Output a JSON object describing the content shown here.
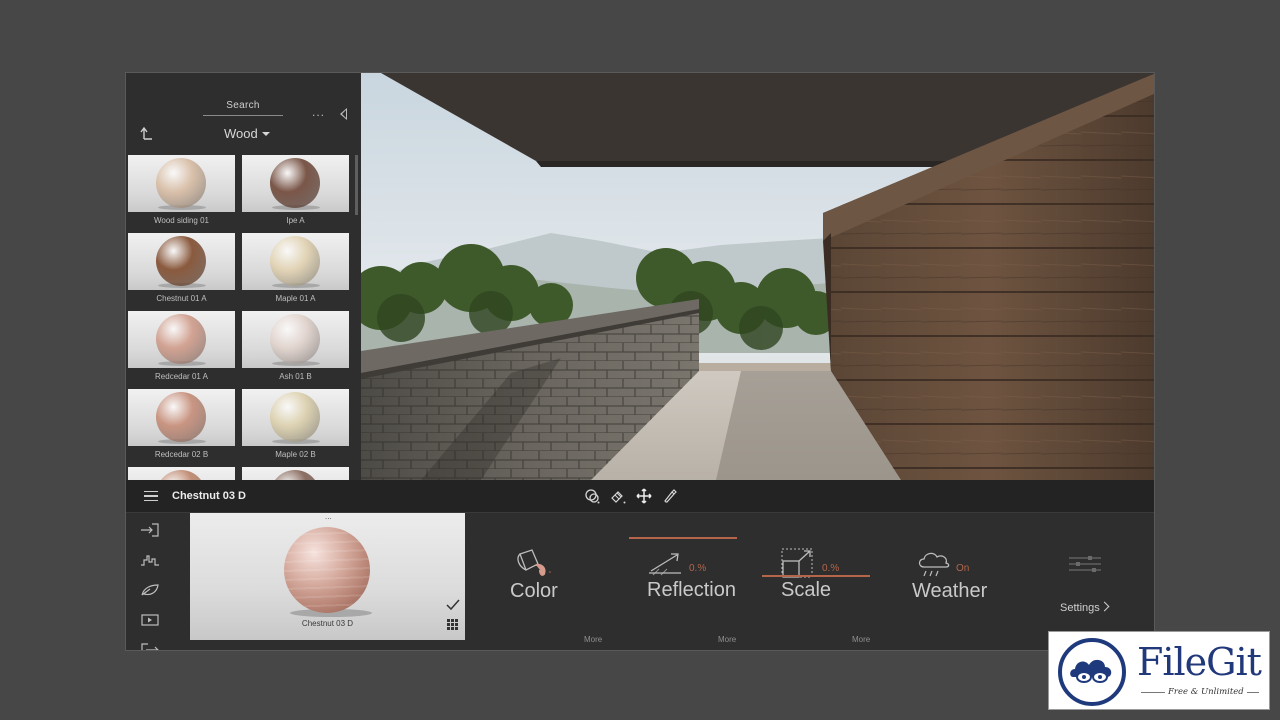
{
  "library": {
    "search_label": "Search",
    "more_label": "...",
    "category": "Wood",
    "materials": [
      {
        "name": "Wood siding 01",
        "tone": "#d9c0aa"
      },
      {
        "name": "Ipe A",
        "tone": "#7a5648"
      },
      {
        "name": "Chestnut 01 A",
        "tone": "#8a5a3e"
      },
      {
        "name": "Maple 01 A",
        "tone": "#e2d4b6"
      },
      {
        "name": "Redcedar 01 A",
        "tone": "#d2a393"
      },
      {
        "name": "Ash 01 B",
        "tone": "#e2d5cf"
      },
      {
        "name": "Redcedar 02 B",
        "tone": "#c99582"
      },
      {
        "name": "Maple 02 B",
        "tone": "#ddd2b2"
      },
      {
        "name": "",
        "tone": "#c28f77"
      },
      {
        "name": "",
        "tone": "#8b6e63"
      }
    ]
  },
  "toolbar": {
    "current_material": "Chestnut 03 D",
    "tools": [
      "material-picker-icon",
      "paint-icon",
      "move-icon",
      "eyedropper-icon"
    ]
  },
  "bottom": {
    "preview_name": "Chestnut 03 D",
    "preview_dots": "...",
    "properties": {
      "color": {
        "label": "Color"
      },
      "reflection": {
        "label": "Reflection",
        "percent": "0.%",
        "level": 0.0
      },
      "scale": {
        "label": "Scale",
        "percent": "0.%",
        "level": 0.0
      },
      "weather": {
        "label": "Weather",
        "status": "On"
      }
    },
    "more_labels": [
      "More",
      "More",
      "More"
    ],
    "settings_label": "Settings",
    "side_icons": [
      "import-icon",
      "waveform-icon",
      "leaf-icon",
      "play-icon",
      "export-icon"
    ]
  },
  "colors": {
    "accent": "#b4654a",
    "panel": "#2e2e2e",
    "toolbar": "#232323"
  },
  "watermark": {
    "title": "FileGit",
    "subtitle": "Free & Unlimited"
  }
}
